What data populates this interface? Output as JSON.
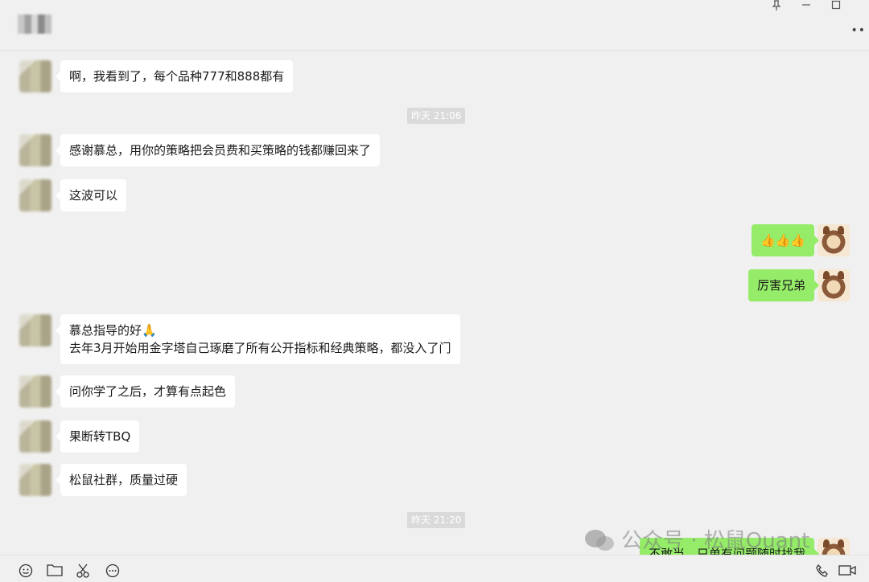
{
  "window": {
    "pin_icon": "pin-icon",
    "minimize_icon": "minimize-icon",
    "maximize_icon": "maximize-icon",
    "more_icon": "more-options-icon"
  },
  "messages": [
    {
      "side": "left",
      "text": "啊，我看到了，每个品种777和888都有"
    },
    {
      "timestamp": "昨天 21:06"
    },
    {
      "side": "left",
      "text": "感谢慕总，用你的策略把会员费和买策略的钱都赚回来了"
    },
    {
      "side": "left",
      "text": "这波可以"
    },
    {
      "side": "right",
      "text": "👍👍👍"
    },
    {
      "side": "right",
      "text": "厉害兄弟"
    },
    {
      "side": "left",
      "line1": "慕总指导的好🙏",
      "line2": "去年3月开始用金字塔自己琢磨了所有公开指标和经典策略，都没入了门"
    },
    {
      "side": "left",
      "text": "问你学了之后，才算有点起色"
    },
    {
      "side": "left",
      "text": "果断转TBQ"
    },
    {
      "side": "left",
      "text": "松鼠社群，质量过硬"
    },
    {
      "timestamp": "昨天 21:20"
    },
    {
      "side": "right",
      "text": "不敢当，只单有问题随时找我"
    }
  ],
  "watermark": {
    "text": "公众号 · 松鼠Quant"
  },
  "toolbar": {
    "emoji_icon": "emoji-icon",
    "folder_icon": "folder-icon",
    "scissors_icon": "scissors-icon",
    "chat_icon": "chat-bubble-icon",
    "phone_icon": "phone-icon",
    "video_icon": "video-call-icon"
  },
  "colors": {
    "incoming_bubble": "#ffffff",
    "outgoing_bubble": "#95ec69",
    "background": "#f0f0f0"
  }
}
